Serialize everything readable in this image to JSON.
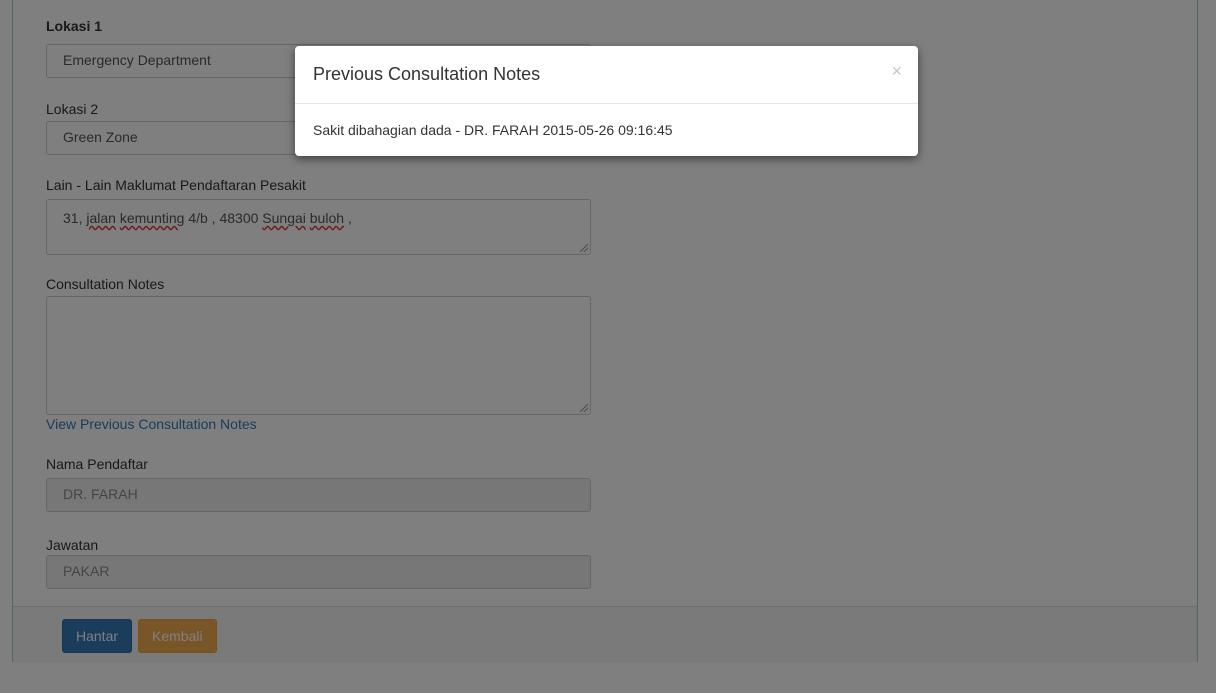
{
  "form": {
    "lokasi1_label": "Lokasi 1",
    "lokasi1_value": "Emergency Department",
    "lokasi2_label": "Lokasi 2",
    "lokasi2_value": "Green Zone",
    "maklumat_label": "Lain - Lain Maklumat Pendaftaran Pesakit",
    "address": {
      "part1": "31,",
      "part2": "jalan",
      "part3": "kemunting",
      "part4": "4/b , 48300",
      "part5": "Sungai",
      "part6": "buloh",
      "part7": ","
    },
    "consultation_label": "Consultation Notes",
    "consultation_value": "",
    "view_previous_link": "View Previous Consultation Notes",
    "nama_label": "Nama Pendaftar",
    "nama_value": "DR. FARAH",
    "jawatan_label": "Jawatan",
    "jawatan_value": "PAKAR"
  },
  "footer": {
    "submit_label": "Hantar",
    "back_label": "Kembali"
  },
  "modal": {
    "title": "Previous Consultation Notes",
    "close_symbol": "×",
    "note": "Sakit dibahagian dada - DR. FARAH 2015-05-26 09:16:45"
  },
  "colors": {
    "primary": "#337ab7",
    "warning": "#f0ad4e",
    "link": "#337ab7",
    "panel_border": "#9fd3c4"
  }
}
